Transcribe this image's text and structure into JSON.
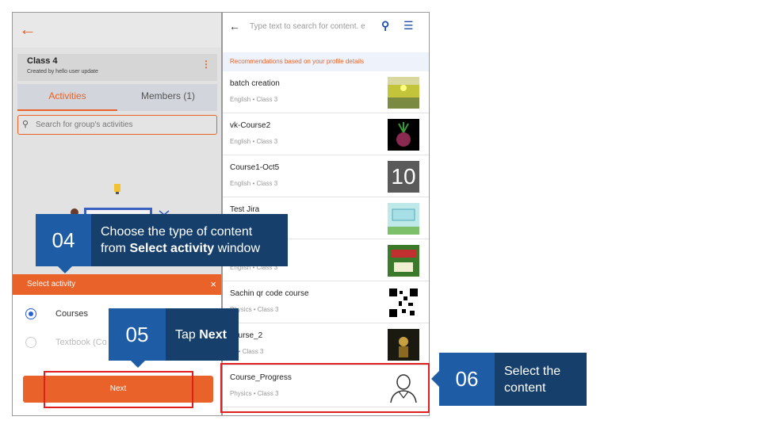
{
  "left_panel": {
    "back_icon": "arrow-left-icon",
    "card": {
      "title": "Class 4",
      "subtitle": "Created by hello user update",
      "menu_icon": "kebab-menu-icon"
    },
    "tabs": [
      {
        "label": "Activities"
      },
      {
        "label": "Members (1)"
      }
    ],
    "search": {
      "placeholder": "Search for group's activities"
    },
    "sheet": {
      "title": "Select activity",
      "close": "×",
      "options": [
        {
          "label": "Courses",
          "selected": true
        },
        {
          "label": "Textbook (Co",
          "selected": false
        }
      ],
      "next_label": "Next"
    }
  },
  "right_panel": {
    "search_placeholder": "Type text to search for content. e",
    "recommendation_label": "Recommendations based on your profile details",
    "items": [
      {
        "title": "batch creation",
        "subtitle": "English • Class 3"
      },
      {
        "title": "vk-Course2",
        "subtitle": "English • Class 3"
      },
      {
        "title": "Course1-Oct5",
        "subtitle": "English • Class 3",
        "thumb_text": "10"
      },
      {
        "title": "Test Jira",
        "subtitle": ""
      },
      {
        "title": "",
        "subtitle": "English • Class 3"
      },
      {
        "title": "Sachin qr code course",
        "subtitle": "Physics • Class 3"
      },
      {
        "title": "course_2",
        "subtitle": "gy • Class 3"
      },
      {
        "title": "Course_Progress",
        "subtitle": "Physics • Class 3"
      }
    ]
  },
  "callouts": {
    "c04": {
      "num": "04",
      "line1": "Choose the type of content",
      "line2_pre": "from ",
      "line2_bold": "Select activity",
      "line2_post": " window"
    },
    "c05": {
      "num": "05",
      "pre": "Tap ",
      "bold": "Next"
    },
    "c06": {
      "num": "06",
      "line1": "Select the",
      "line2": "content"
    }
  },
  "colors": {
    "accent": "#e8622a",
    "callout_num": "#1f5ca6",
    "callout_text": "#173f6b",
    "highlight": "#e02020"
  }
}
